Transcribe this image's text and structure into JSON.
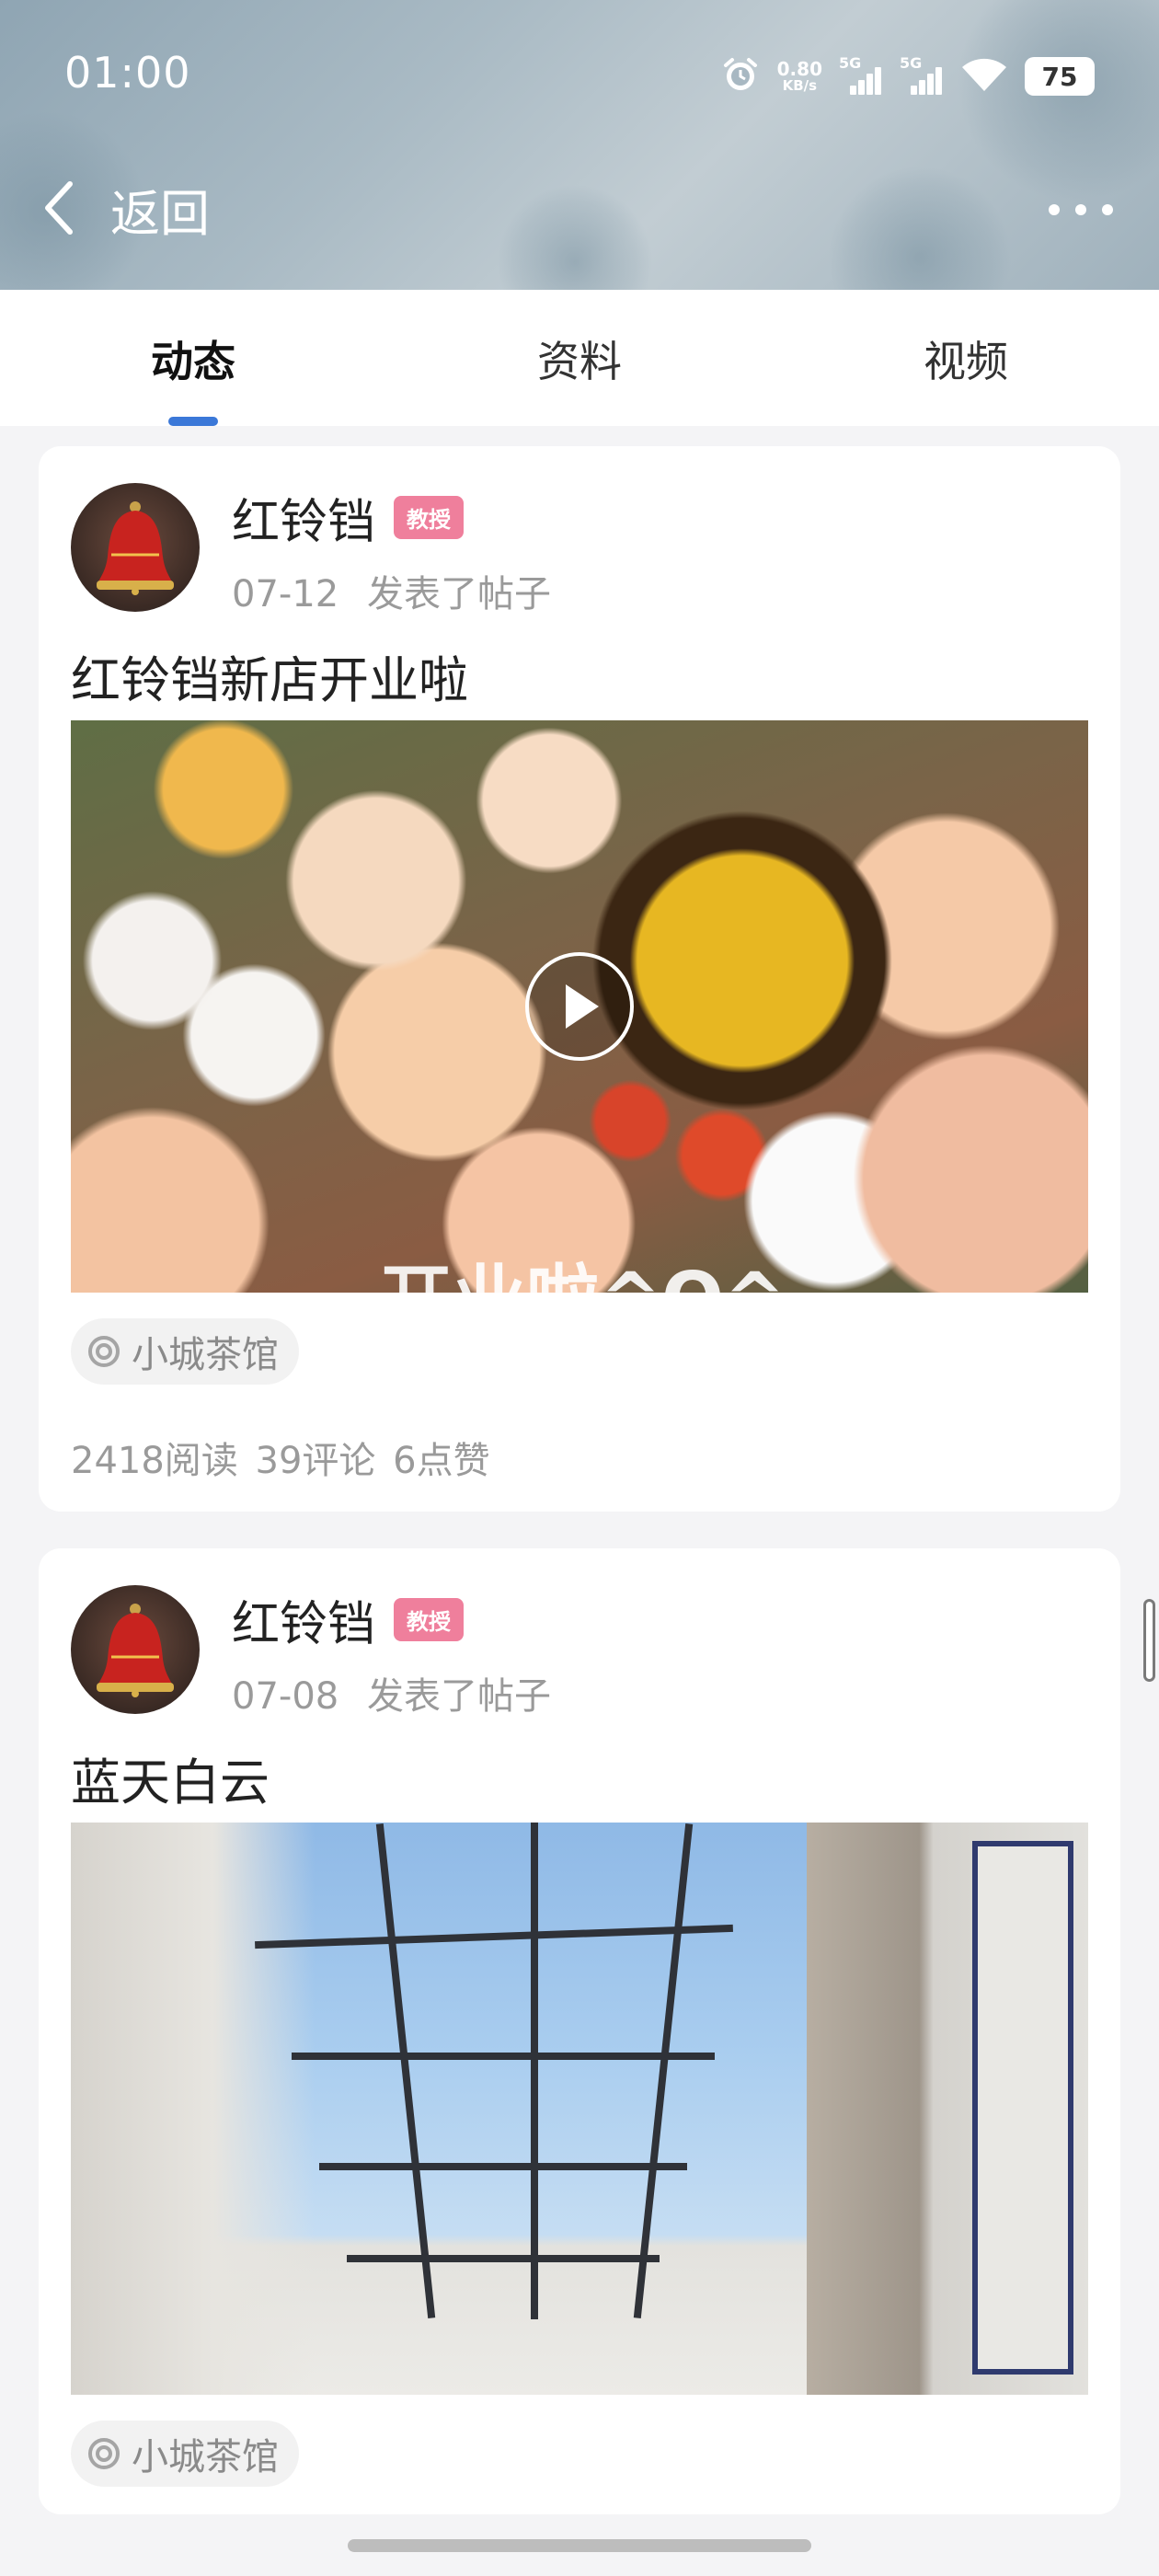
{
  "status_bar": {
    "time": "01:00",
    "net_speed_value": "0.80",
    "net_speed_unit": "KB/s",
    "sim1_label": "5G",
    "sim2_label": "5G",
    "battery": "75"
  },
  "nav": {
    "back_label": "返回"
  },
  "tabs": [
    {
      "label": "动态",
      "active": true
    },
    {
      "label": "资料",
      "active": false
    },
    {
      "label": "视频",
      "active": false
    }
  ],
  "posts": [
    {
      "author": "红铃铛",
      "badge": "教授",
      "date": "07-12",
      "action": "发表了帖子",
      "title": "红铃铛新店开业啦",
      "media_type": "video",
      "overlay_text": "开业啦^O^",
      "location": "小城茶馆",
      "stats": {
        "reads": "2418阅读",
        "comments": "39评论",
        "likes": "6点赞"
      }
    },
    {
      "author": "红铃铛",
      "badge": "教授",
      "date": "07-08",
      "action": "发表了帖子",
      "title": "蓝天白云",
      "media_type": "image",
      "location": "小城茶馆"
    }
  ],
  "colors": {
    "accent": "#3b78d8",
    "badge": "#ef7f9c"
  }
}
